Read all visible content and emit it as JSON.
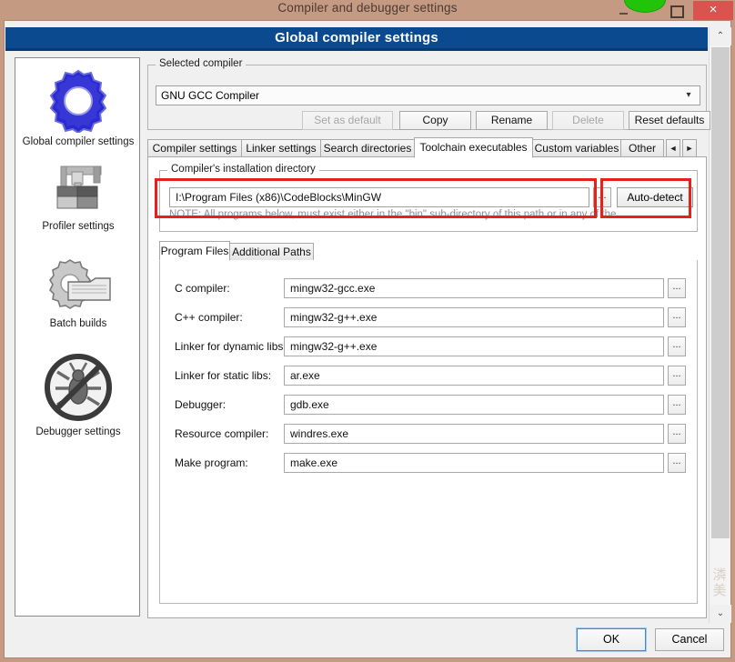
{
  "window": {
    "title": "Compiler and debugger settings",
    "header": "Global compiler settings",
    "minimize_icon": "minimize-icon",
    "maximize_icon": "maximize-icon",
    "close_icon": "close-icon",
    "close_label": "×",
    "watermark": "潾美"
  },
  "sidebar": {
    "items": [
      {
        "label": "Global compiler settings",
        "icon": "gear-blue-icon"
      },
      {
        "label": "Profiler settings",
        "icon": "caliper-icon"
      },
      {
        "label": "Batch builds",
        "icon": "gear-folder-icon"
      },
      {
        "label": "Debugger settings",
        "icon": "no-bug-icon"
      }
    ]
  },
  "selected_compiler": {
    "group_title": "Selected compiler",
    "value": "GNU GCC Compiler",
    "dropdown_icon": "chevron-down-icon",
    "buttons": [
      {
        "label": "Set as default",
        "enabled": false
      },
      {
        "label": "Copy",
        "enabled": true
      },
      {
        "label": "Rename",
        "enabled": true
      },
      {
        "label": "Delete",
        "enabled": false
      },
      {
        "label": "Reset defaults",
        "enabled": true
      }
    ]
  },
  "tabs": {
    "items": [
      {
        "label": "Compiler settings",
        "active": false
      },
      {
        "label": "Linker settings",
        "active": false
      },
      {
        "label": "Search directories",
        "active": false
      },
      {
        "label": "Toolchain executables",
        "active": true
      },
      {
        "label": "Custom variables",
        "active": false
      },
      {
        "label": "Other",
        "active": false
      }
    ],
    "nav_prev": "◄",
    "nav_next": "►"
  },
  "install_dir": {
    "group_title": "Compiler's installation directory",
    "value": "I:\\Program Files (x86)\\CodeBlocks\\MinGW",
    "browse_label": "...",
    "autodetect_label": "Auto-detect",
    "note": "NOTE: All programs below, must exist either in the \"bin\" sub-directory of this path or in any of the"
  },
  "inner_tabs": {
    "items": [
      {
        "label": "Program Files",
        "active": true
      },
      {
        "label": "Additional Paths",
        "active": false
      }
    ]
  },
  "program_files": {
    "browse_label": "...",
    "rows": [
      {
        "label": "C compiler:",
        "value": "mingw32-gcc.exe"
      },
      {
        "label": "C++ compiler:",
        "value": "mingw32-g++.exe"
      },
      {
        "label": "Linker for dynamic libs:",
        "value": "mingw32-g++.exe"
      },
      {
        "label": "Linker for static libs:",
        "value": "ar.exe"
      },
      {
        "label": "Debugger:",
        "value": "gdb.exe"
      },
      {
        "label": "Resource compiler:",
        "value": "windres.exe"
      },
      {
        "label": "Make program:",
        "value": "make.exe"
      }
    ]
  },
  "footer": {
    "ok_label": "OK",
    "cancel_label": "Cancel"
  },
  "scrollbar": {
    "up_icon": "chevron-up-icon",
    "down_icon": "chevron-down-icon",
    "up_glyph": "⌃",
    "down_glyph": "⌄"
  },
  "colors": {
    "frame": "#c49a82",
    "header_blue": "#0b4a8f",
    "annotation_red": "#e8201b",
    "close_red": "#d9534f",
    "green_badge": "#22c40a"
  }
}
